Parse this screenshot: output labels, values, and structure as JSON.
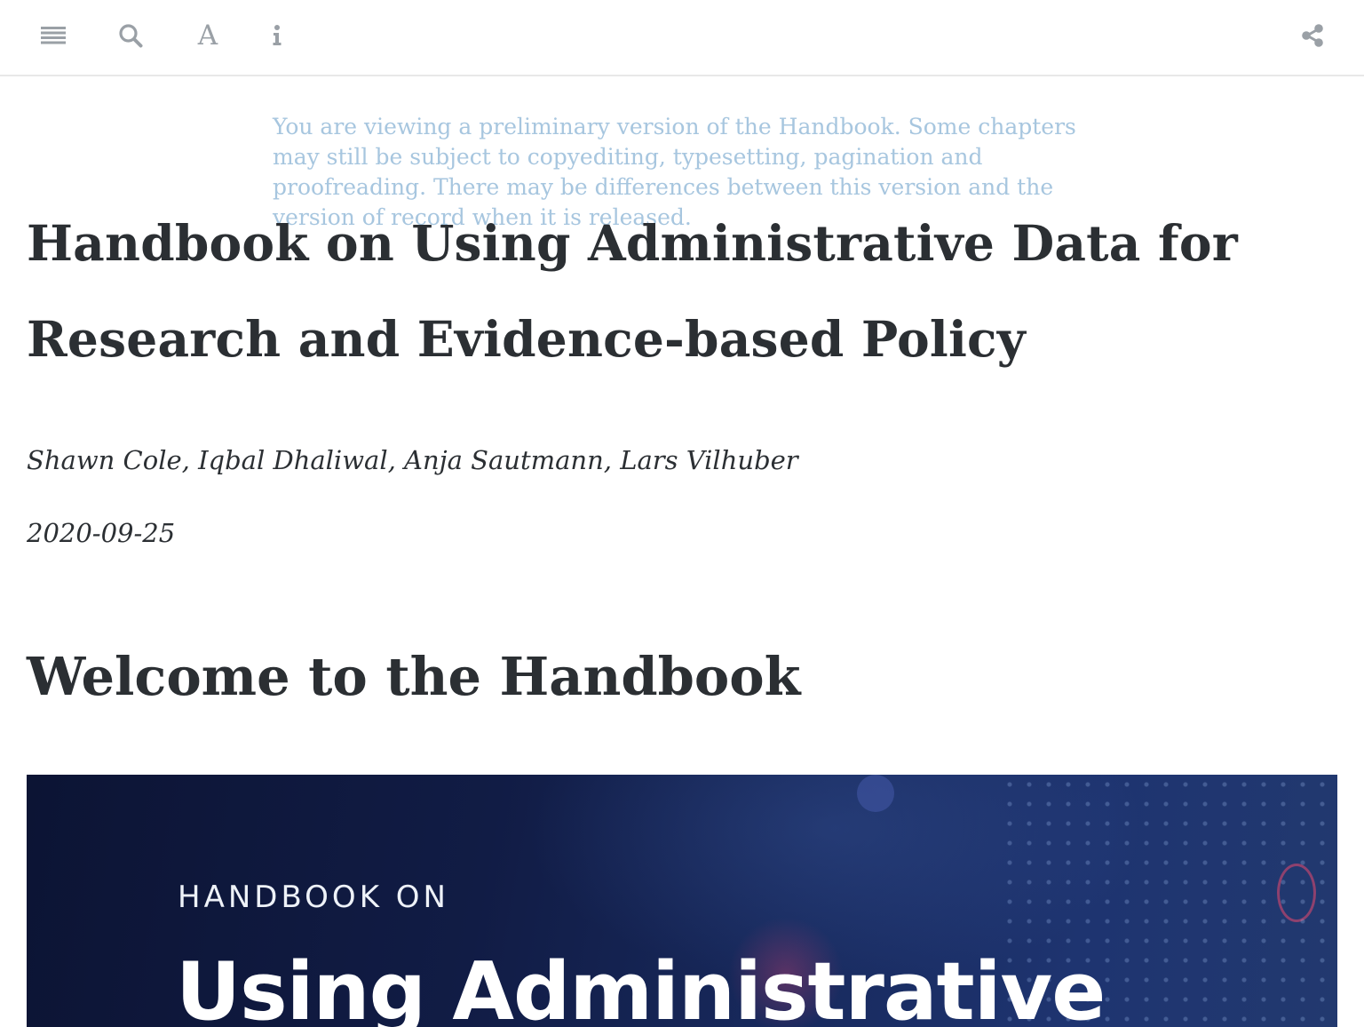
{
  "toolbar": {
    "buttons": [
      {
        "icon": "menu-lines-icon",
        "label": "Toggle Sidebar"
      },
      {
        "icon": "search-icon",
        "label": "Search"
      },
      {
        "icon": "font-settings-icon",
        "label": "A"
      },
      {
        "icon": "info-icon",
        "label": "Information"
      },
      {
        "icon": "share-icon",
        "label": "Share"
      }
    ],
    "icon_color": "#9aa0a6"
  },
  "notice": {
    "text": "You are viewing a preliminary version of the Handbook. Some chapters may still be subject to copyediting, typesetting, pagination and proofreading. There may be differences between this version and the version of record when it is released.",
    "color": "#a7c6df"
  },
  "book": {
    "title": "Handbook on Using Administrative Data for Research and Evidence-based Policy",
    "authors": "Shawn Cole, Iqbal Dhaliwal, Anja Sautmann, Lars Vilhuber",
    "date": "2020-09-25"
  },
  "section": {
    "title": "Welcome to the Handbook"
  },
  "cover_image": {
    "kicker": "HANDBOOK ON",
    "title": "Using Administrative",
    "background": "#111c45"
  }
}
